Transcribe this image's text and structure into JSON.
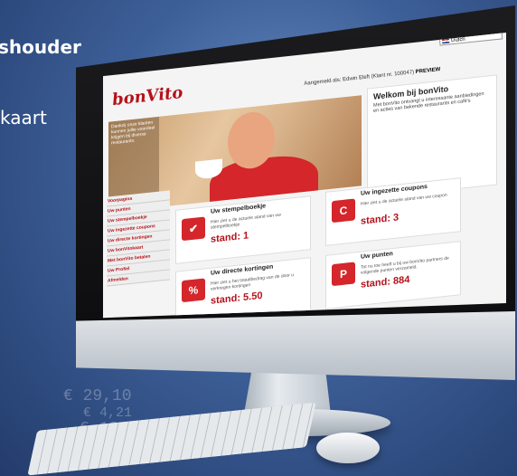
{
  "background": {
    "heading": "shouder",
    "sub": "kaart",
    "prices": [
      "€ 29,10",
      "€ 4,21",
      "€ 10"
    ]
  },
  "screen": {
    "login": "Aangemeld als: Edwin Eleft (Klant nr. 100047)",
    "preview": "PREVIEW",
    "language": "Dutch",
    "logo": "bonVito",
    "hero_side_text": "Dankzij onze klanten kunnen jullie voordeel krijgen bij diverse restaurants.",
    "welcome": {
      "title": "Welkom bij bonVito",
      "text": "Met bonVito ontvangt u interessante aanbiedingen en acties van bekende restaurants en café's"
    },
    "nav": [
      "Voorpagina",
      "Uw punten",
      "Uw stempelboekje",
      "Uw ingezette coupons",
      "Uw directe kortingen",
      "Uw bonVitokaart",
      "Met bonVito betalen",
      "Uw Profiel",
      "Afmelden"
    ],
    "cards": [
      {
        "title": "Uw stempelboekje",
        "text": "Hier ziet u de actuele stand van uw stempelboekje",
        "stand": "stand: 1",
        "icon": "✔"
      },
      {
        "title": "Uw ingezette coupons",
        "text": "Hier ziet u de actuele stand van uw coupon",
        "stand": "stand: 3",
        "icon": "C"
      },
      {
        "title": "Uw directe kortingen",
        "text": "Hier ziet u het totaalbedrag van de door u verkregen kortingen",
        "stand": "stand: 5.50",
        "icon": "%"
      },
      {
        "title": "Uw punten",
        "text": "Tot nu toe heeft u bij uw bonVito partners de volgende punten verzameld.",
        "stand": "stand: 884",
        "icon": "P"
      }
    ]
  }
}
